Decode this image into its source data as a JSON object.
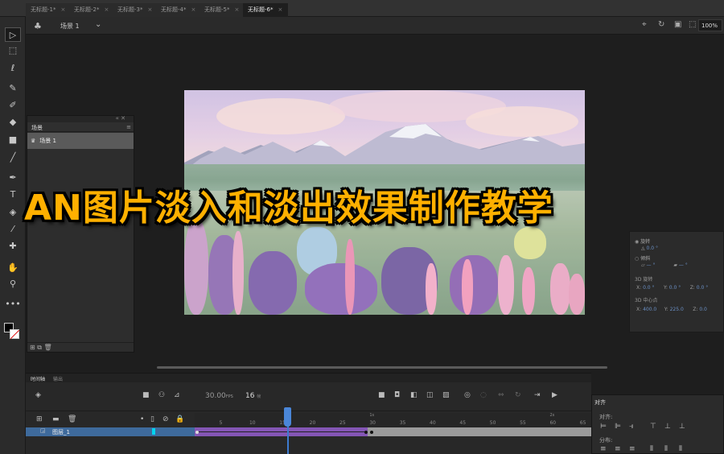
{
  "tabs": [
    {
      "label": "无标题-1*",
      "active": false
    },
    {
      "label": "无标题-2*",
      "active": false
    },
    {
      "label": "无标题-3*",
      "active": false
    },
    {
      "label": "无标题-4*",
      "active": false
    },
    {
      "label": "无标题-5*",
      "active": false
    },
    {
      "label": "无标题-6*",
      "active": true
    }
  ],
  "tab_close": "×",
  "scene_bar": {
    "scene_label": "场景 1",
    "zoom": "100%",
    "icons": [
      "scene-clapper-icon",
      "dropdown-caret-icon",
      "center-stage-icon",
      "rotate-stage-icon",
      "clip-content-icon",
      "fit-icon"
    ]
  },
  "toolbar_icons": [
    "selection-tool",
    "free-transform-tool",
    "lasso-tool",
    "brush-tool",
    "pencil-tool",
    "eraser-tool",
    "rectangle-tool",
    "line-tool",
    "pen-tool",
    "text-tool",
    "paint-bucket-tool",
    "eyedropper-tool",
    "pin-tool",
    "hand-tool",
    "zoom-tool",
    "more-tools"
  ],
  "scene_panel": {
    "title": "场景",
    "item": "场景 1"
  },
  "overlay_title": "AN图片淡入和淡出效果制作教学",
  "properties": {
    "rotate_label": "旋转",
    "rotate_value": "0.0 °",
    "skew_label": "倾斜",
    "skew_value_1": "— °",
    "skew_value_2": "— °",
    "rot3d_label": "3D 旋转",
    "x_label": "X:",
    "x_value": "0.0 °",
    "y_label": "Y:",
    "y_value": "0.0 °",
    "z_label": "Z:",
    "z_value": "0.0 °",
    "center_label": "3D 中心点",
    "cx_label": "X:",
    "cx_value": "400.0",
    "cy_label": "Y:",
    "cy_value": "225.0",
    "cz_label": "Z:",
    "cz_value": "0.0"
  },
  "timeline": {
    "tab_active": "时间轴",
    "tab_other": "输出",
    "fps": "30.00",
    "fps_unit": "FPS",
    "current_frame": "16",
    "frame_unit": "帧",
    "layer_name": "图层_1",
    "ruler_marks": [
      "1s",
      "5",
      "10",
      "15",
      "20",
      "25",
      "30",
      "2s",
      "35",
      "40",
      "45",
      "50",
      "55",
      "60",
      "65"
    ],
    "tween_end_frame": 30,
    "total_visible_frames": 66,
    "playhead_frame": 16
  },
  "align_panel": {
    "title": "对齐",
    "align_label": "对齐:",
    "distribute_label": "分布:"
  },
  "colors": {
    "accent_title": "#ffb000",
    "layer_selected": "#3e6a9c",
    "tween": "#8456b5",
    "playhead": "#3d7bd0"
  }
}
